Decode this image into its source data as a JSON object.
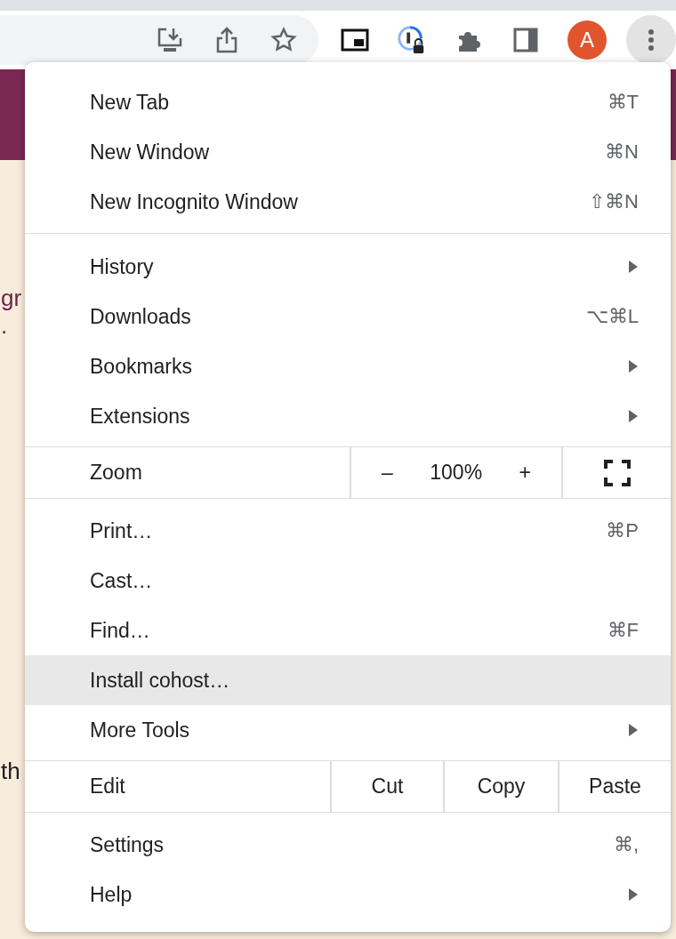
{
  "page": {
    "texts": [
      "gr",
      ".",
      "th"
    ]
  },
  "avatar": {
    "letter": "A"
  },
  "menu": {
    "sections": [
      {
        "kind": "items",
        "items": [
          {
            "label": "New Tab",
            "shortcut": "⌘T",
            "submenu": false,
            "highlighted": false
          },
          {
            "label": "New Window",
            "shortcut": "⌘N",
            "submenu": false,
            "highlighted": false
          },
          {
            "label": "New Incognito Window",
            "shortcut": "⇧⌘N",
            "submenu": false,
            "highlighted": false
          }
        ]
      },
      {
        "kind": "items",
        "items": [
          {
            "label": "History",
            "submenu": true,
            "highlighted": false
          },
          {
            "label": "Downloads",
            "shortcut": "⌥⌘L",
            "submenu": false,
            "highlighted": false
          },
          {
            "label": "Bookmarks",
            "submenu": true,
            "highlighted": false
          },
          {
            "label": "Extensions",
            "submenu": true,
            "highlighted": false
          }
        ]
      },
      {
        "kind": "zoom",
        "label": "Zoom",
        "minus": "–",
        "value": "100%",
        "plus": "+"
      },
      {
        "kind": "items",
        "items": [
          {
            "label": "Print…",
            "shortcut": "⌘P",
            "submenu": false,
            "highlighted": false
          },
          {
            "label": "Cast…",
            "submenu": false,
            "highlighted": false
          },
          {
            "label": "Find…",
            "shortcut": "⌘F",
            "submenu": false,
            "highlighted": false
          },
          {
            "label": "Install cohost…",
            "submenu": false,
            "highlighted": true
          },
          {
            "label": "More Tools",
            "submenu": true,
            "highlighted": false
          }
        ]
      },
      {
        "kind": "edit",
        "label": "Edit",
        "actions": [
          "Cut",
          "Copy",
          "Paste"
        ]
      },
      {
        "kind": "items",
        "items": [
          {
            "label": "Settings",
            "shortcut": "⌘,",
            "submenu": false,
            "highlighted": false
          },
          {
            "label": "Help",
            "submenu": true,
            "highlighted": false
          }
        ]
      }
    ]
  }
}
